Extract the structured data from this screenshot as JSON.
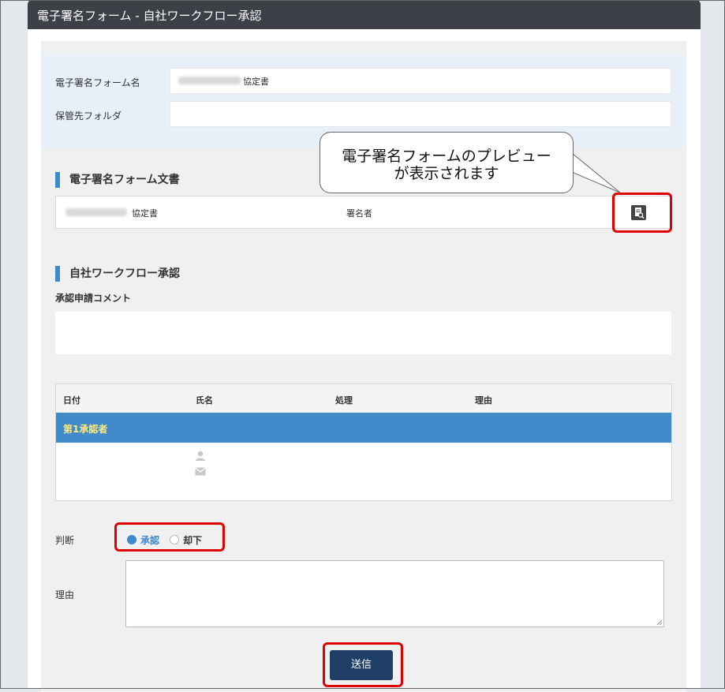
{
  "window": {
    "title": "電子署名フォーム - 自社ワークフロー承認"
  },
  "form": {
    "name_label": "電子署名フォーム名",
    "name_value": "協定書",
    "folder_label": "保管先フォルダ",
    "folder_value": ""
  },
  "document_section": {
    "title": "電子署名フォーム文書",
    "doc_name": "協定書",
    "signer": "署名者",
    "preview_icon": "document-search-icon"
  },
  "workflow_section": {
    "title": "自社ワークフロー承認",
    "comment_label": "承認申請コメント",
    "comment_value": "",
    "columns": [
      "日付",
      "氏名",
      "処理",
      "理由"
    ],
    "approver_group": "第1承認者",
    "approver_icons": [
      "user-icon",
      "mail-icon"
    ]
  },
  "decision": {
    "label": "判断",
    "options": [
      "承認",
      "却下"
    ],
    "selected": "承認"
  },
  "reason": {
    "label": "理由",
    "value": ""
  },
  "submit_label": "送信",
  "callout": {
    "line1": "電子署名フォームのプレビュー",
    "line2": "が表示されます"
  },
  "colors": {
    "accent": "#3f89cf",
    "group_row": "#428bca",
    "group_text": "#ffe97a",
    "submit": "#1f3f66",
    "highlight": "#e00000",
    "titlebar": "#3d4147"
  }
}
